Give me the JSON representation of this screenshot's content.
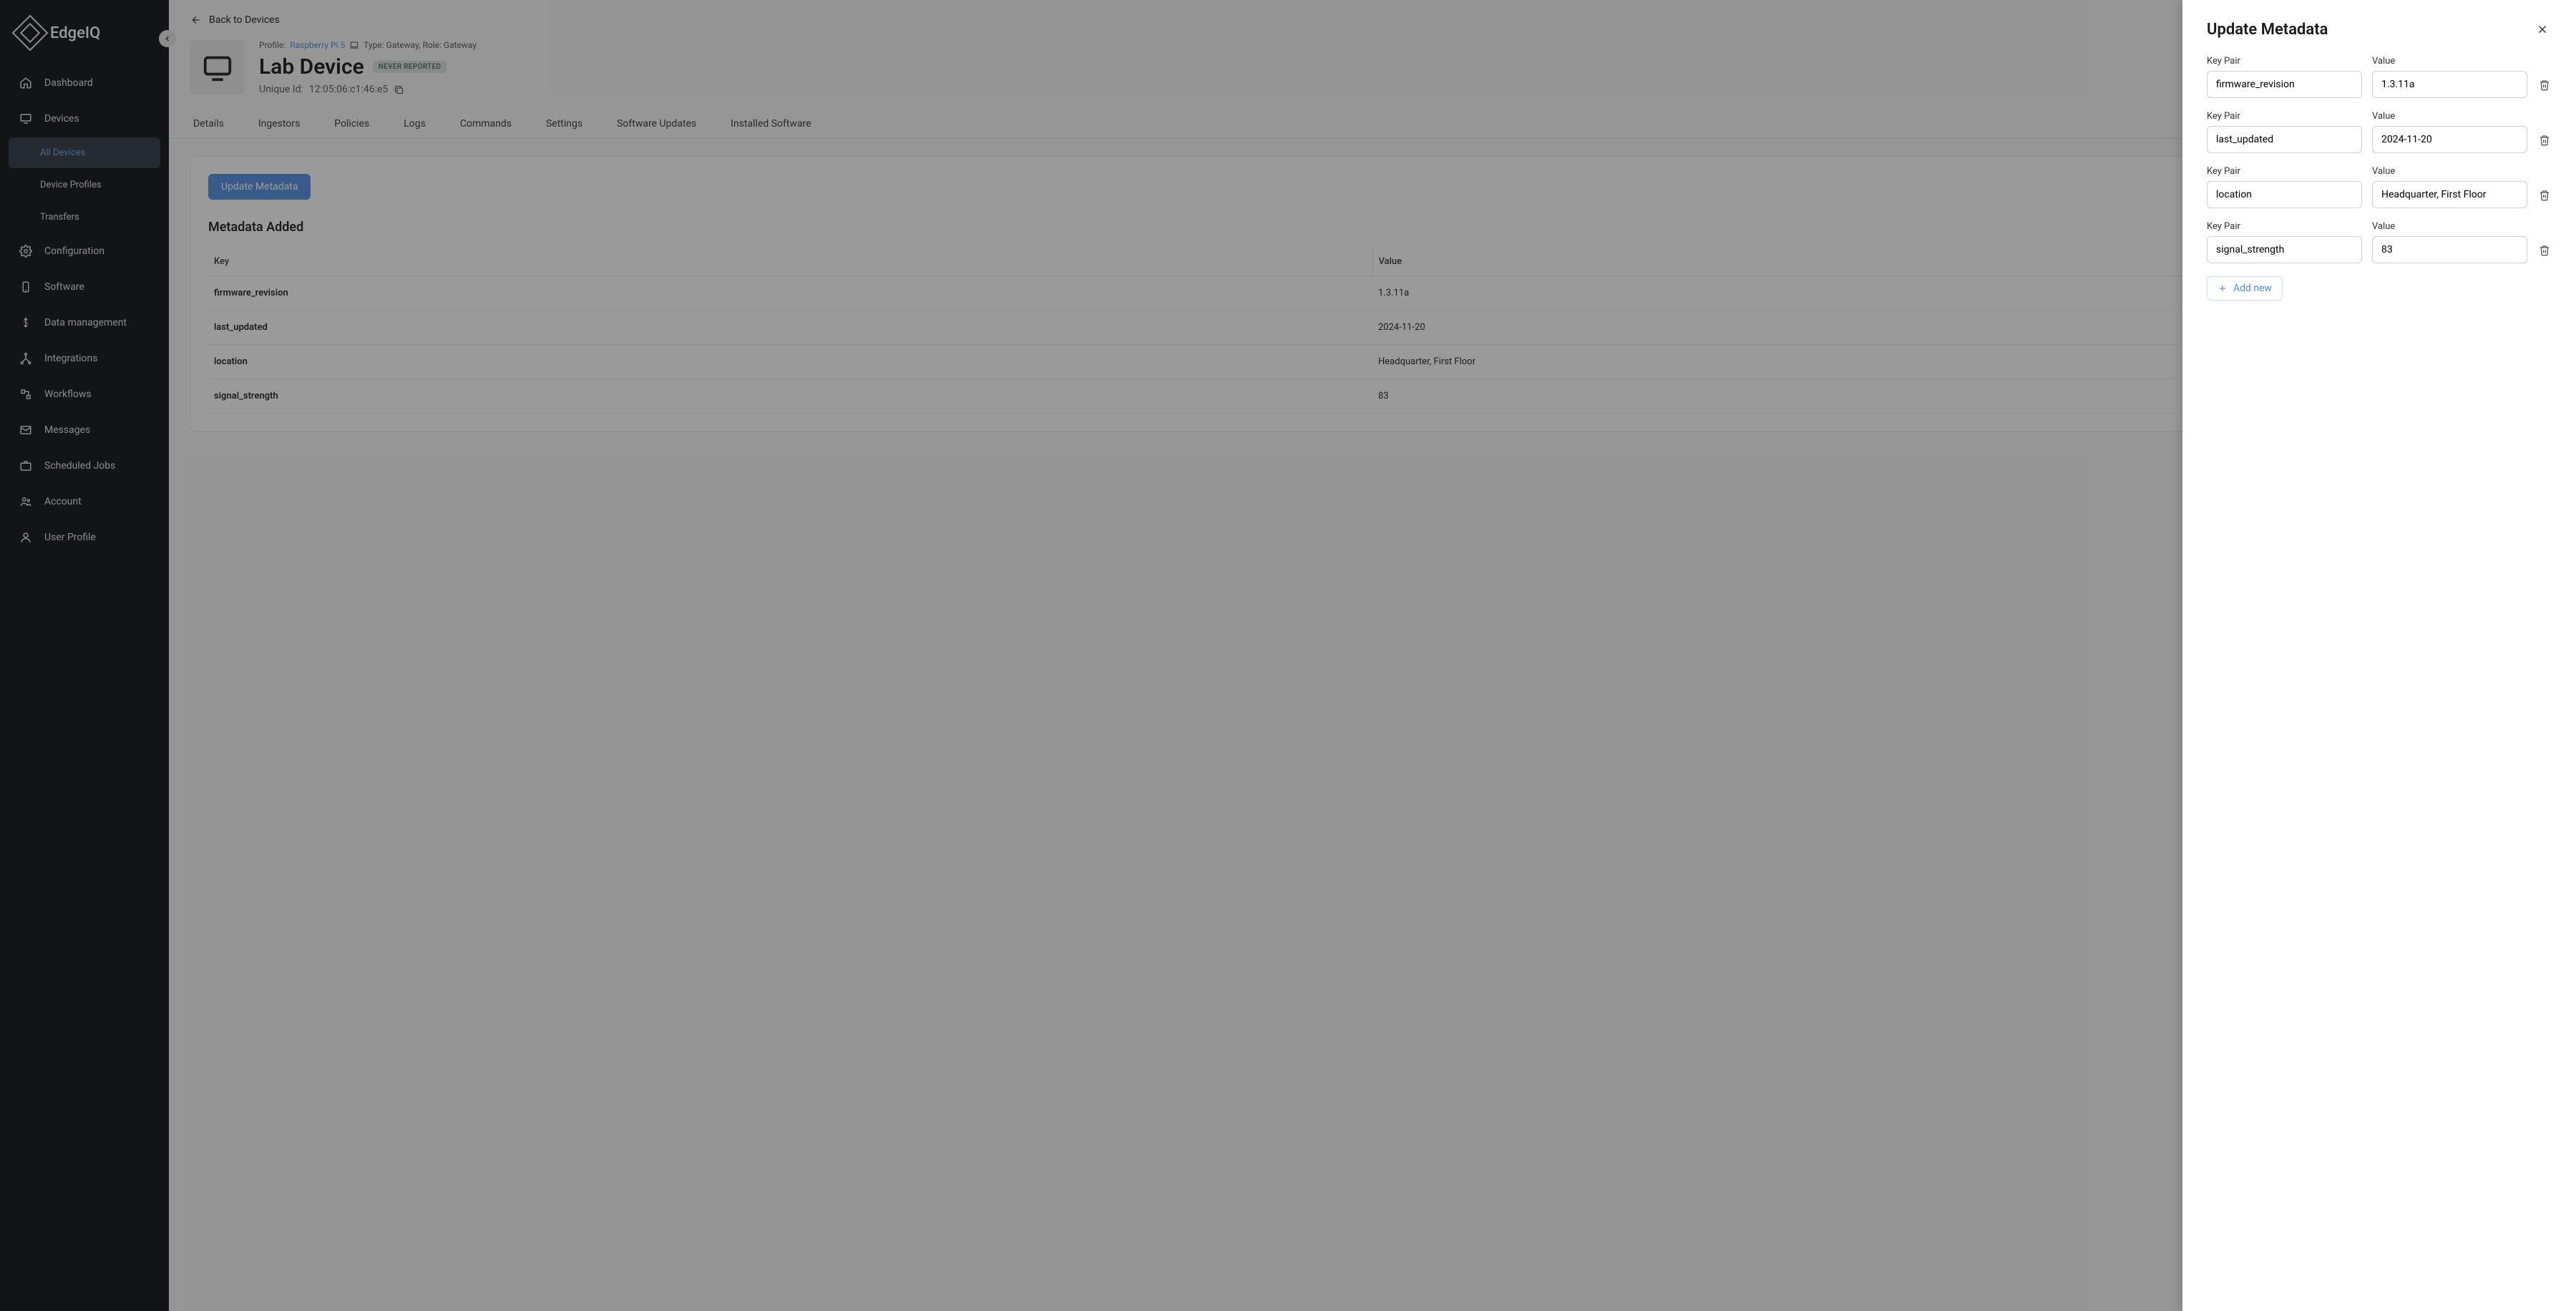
{
  "app_name": "EdgeIQ",
  "sidebar": {
    "items": [
      {
        "label": "Dashboard",
        "icon": "home"
      },
      {
        "label": "Devices",
        "icon": "monitor"
      },
      {
        "label": "All Devices",
        "sub": true,
        "active": true
      },
      {
        "label": "Device Profiles",
        "sub": true
      },
      {
        "label": "Transfers",
        "sub": true
      },
      {
        "label": "Configuration",
        "icon": "gear"
      },
      {
        "label": "Software",
        "icon": "phone"
      },
      {
        "label": "Data management",
        "icon": "usb"
      },
      {
        "label": "Integrations",
        "icon": "tree"
      },
      {
        "label": "Workflows",
        "icon": "flow"
      },
      {
        "label": "Messages",
        "icon": "mail"
      },
      {
        "label": "Scheduled Jobs",
        "icon": "briefcase"
      },
      {
        "label": "Account",
        "icon": "people"
      },
      {
        "label": "User Profile",
        "icon": "person"
      }
    ]
  },
  "back_link": "Back to Devices",
  "device": {
    "profile_label": "Profile:",
    "profile_name": "Raspberry Pi 5",
    "type_label": "Type: Gateway, Role: Gateway",
    "name": "Lab Device",
    "badge": "NEVER REPORTED",
    "id_label": "Unique Id:",
    "id_value": "12:05:06:c1:46:e5"
  },
  "tabs": [
    {
      "label": "Details"
    },
    {
      "label": "Ingestors"
    },
    {
      "label": "Policies"
    },
    {
      "label": "Logs"
    },
    {
      "label": "Commands"
    },
    {
      "label": "Settings"
    },
    {
      "label": "Software Updates"
    },
    {
      "label": "Installed Software"
    }
  ],
  "content": {
    "update_btn": "Update Metadata",
    "section_title": "Metadata Added",
    "table": {
      "headers": {
        "key": "Key",
        "value": "Value"
      },
      "rows": [
        {
          "key": "firmware_revision",
          "value": "1.3.11a"
        },
        {
          "key": "last_updated",
          "value": "2024-11-20"
        },
        {
          "key": "location",
          "value": "Headquarter, First Floor"
        },
        {
          "key": "signal_strength",
          "value": "83"
        }
      ]
    }
  },
  "drawer": {
    "title": "Update Metadata",
    "key_label": "Key Pair",
    "value_label": "Value",
    "rows": [
      {
        "key": "firmware_revision",
        "value": "1.3.11a"
      },
      {
        "key": "last_updated",
        "value": "2024-11-20"
      },
      {
        "key": "location",
        "value": "Headquarter, First Floor"
      },
      {
        "key": "signal_strength",
        "value": "83"
      }
    ],
    "add_new": "Add new"
  }
}
